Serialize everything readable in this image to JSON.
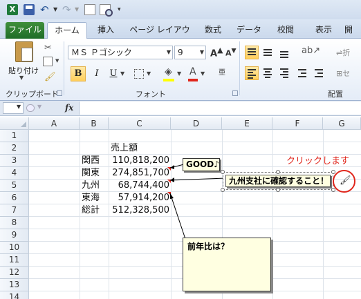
{
  "qat": {
    "app_icon": "X",
    "icons": [
      "excel-logo-icon",
      "save-icon",
      "undo-icon",
      "redo-icon",
      "new-document-icon",
      "print-preview-icon",
      "customize-toolbar-icon"
    ]
  },
  "tabs": {
    "file": "ファイル",
    "home": "ホーム",
    "insert": "挿入",
    "page_layout": "ページ レイアウト",
    "formulas": "数式",
    "data": "データ",
    "review": "校閲",
    "view": "表示",
    "more": "開"
  },
  "ribbon": {
    "clipboard": {
      "paste": "貼り付け",
      "group_label": "クリップボード"
    },
    "font": {
      "font_name": "ＭＳ Ｐゴシック",
      "font_size": "9",
      "bold": "B",
      "italic": "I",
      "underline": "U",
      "group_label": "フォント",
      "grow": "A",
      "shrink": "A",
      "phonetic": "亜"
    },
    "alignment": {
      "group_label": "配置",
      "wrap": "折",
      "merge": "セ"
    }
  },
  "formula_bar": {
    "fx": "fx",
    "name_box": "",
    "value": ""
  },
  "columns": [
    "A",
    "B",
    "C",
    "D",
    "E",
    "F",
    "G"
  ],
  "rows": [
    "1",
    "2",
    "3",
    "4",
    "5",
    "6",
    "7",
    "8",
    "9",
    "10",
    "11",
    "12",
    "13",
    "14"
  ],
  "sheet": {
    "header": "売上額",
    "regions": [
      {
        "name": "関西",
        "amount": "110,818,200"
      },
      {
        "name": "関東",
        "amount": "274,851,700"
      },
      {
        "name": "九州",
        "amount": "68,744,400"
      },
      {
        "name": "東海",
        "amount": "57,914,200"
      }
    ],
    "total": {
      "name": "総計",
      "amount": "512,328,500"
    }
  },
  "comments": {
    "good": "GOOD♪",
    "kyushu": "九州支社に確認すること！",
    "yoy": "前年比は？"
  },
  "annotation": {
    "click_here": "クリックします"
  },
  "colors": {
    "accent_red": "#e0261c",
    "comment_bg": "#ffffe1",
    "file_tab": "#2f7d32"
  }
}
